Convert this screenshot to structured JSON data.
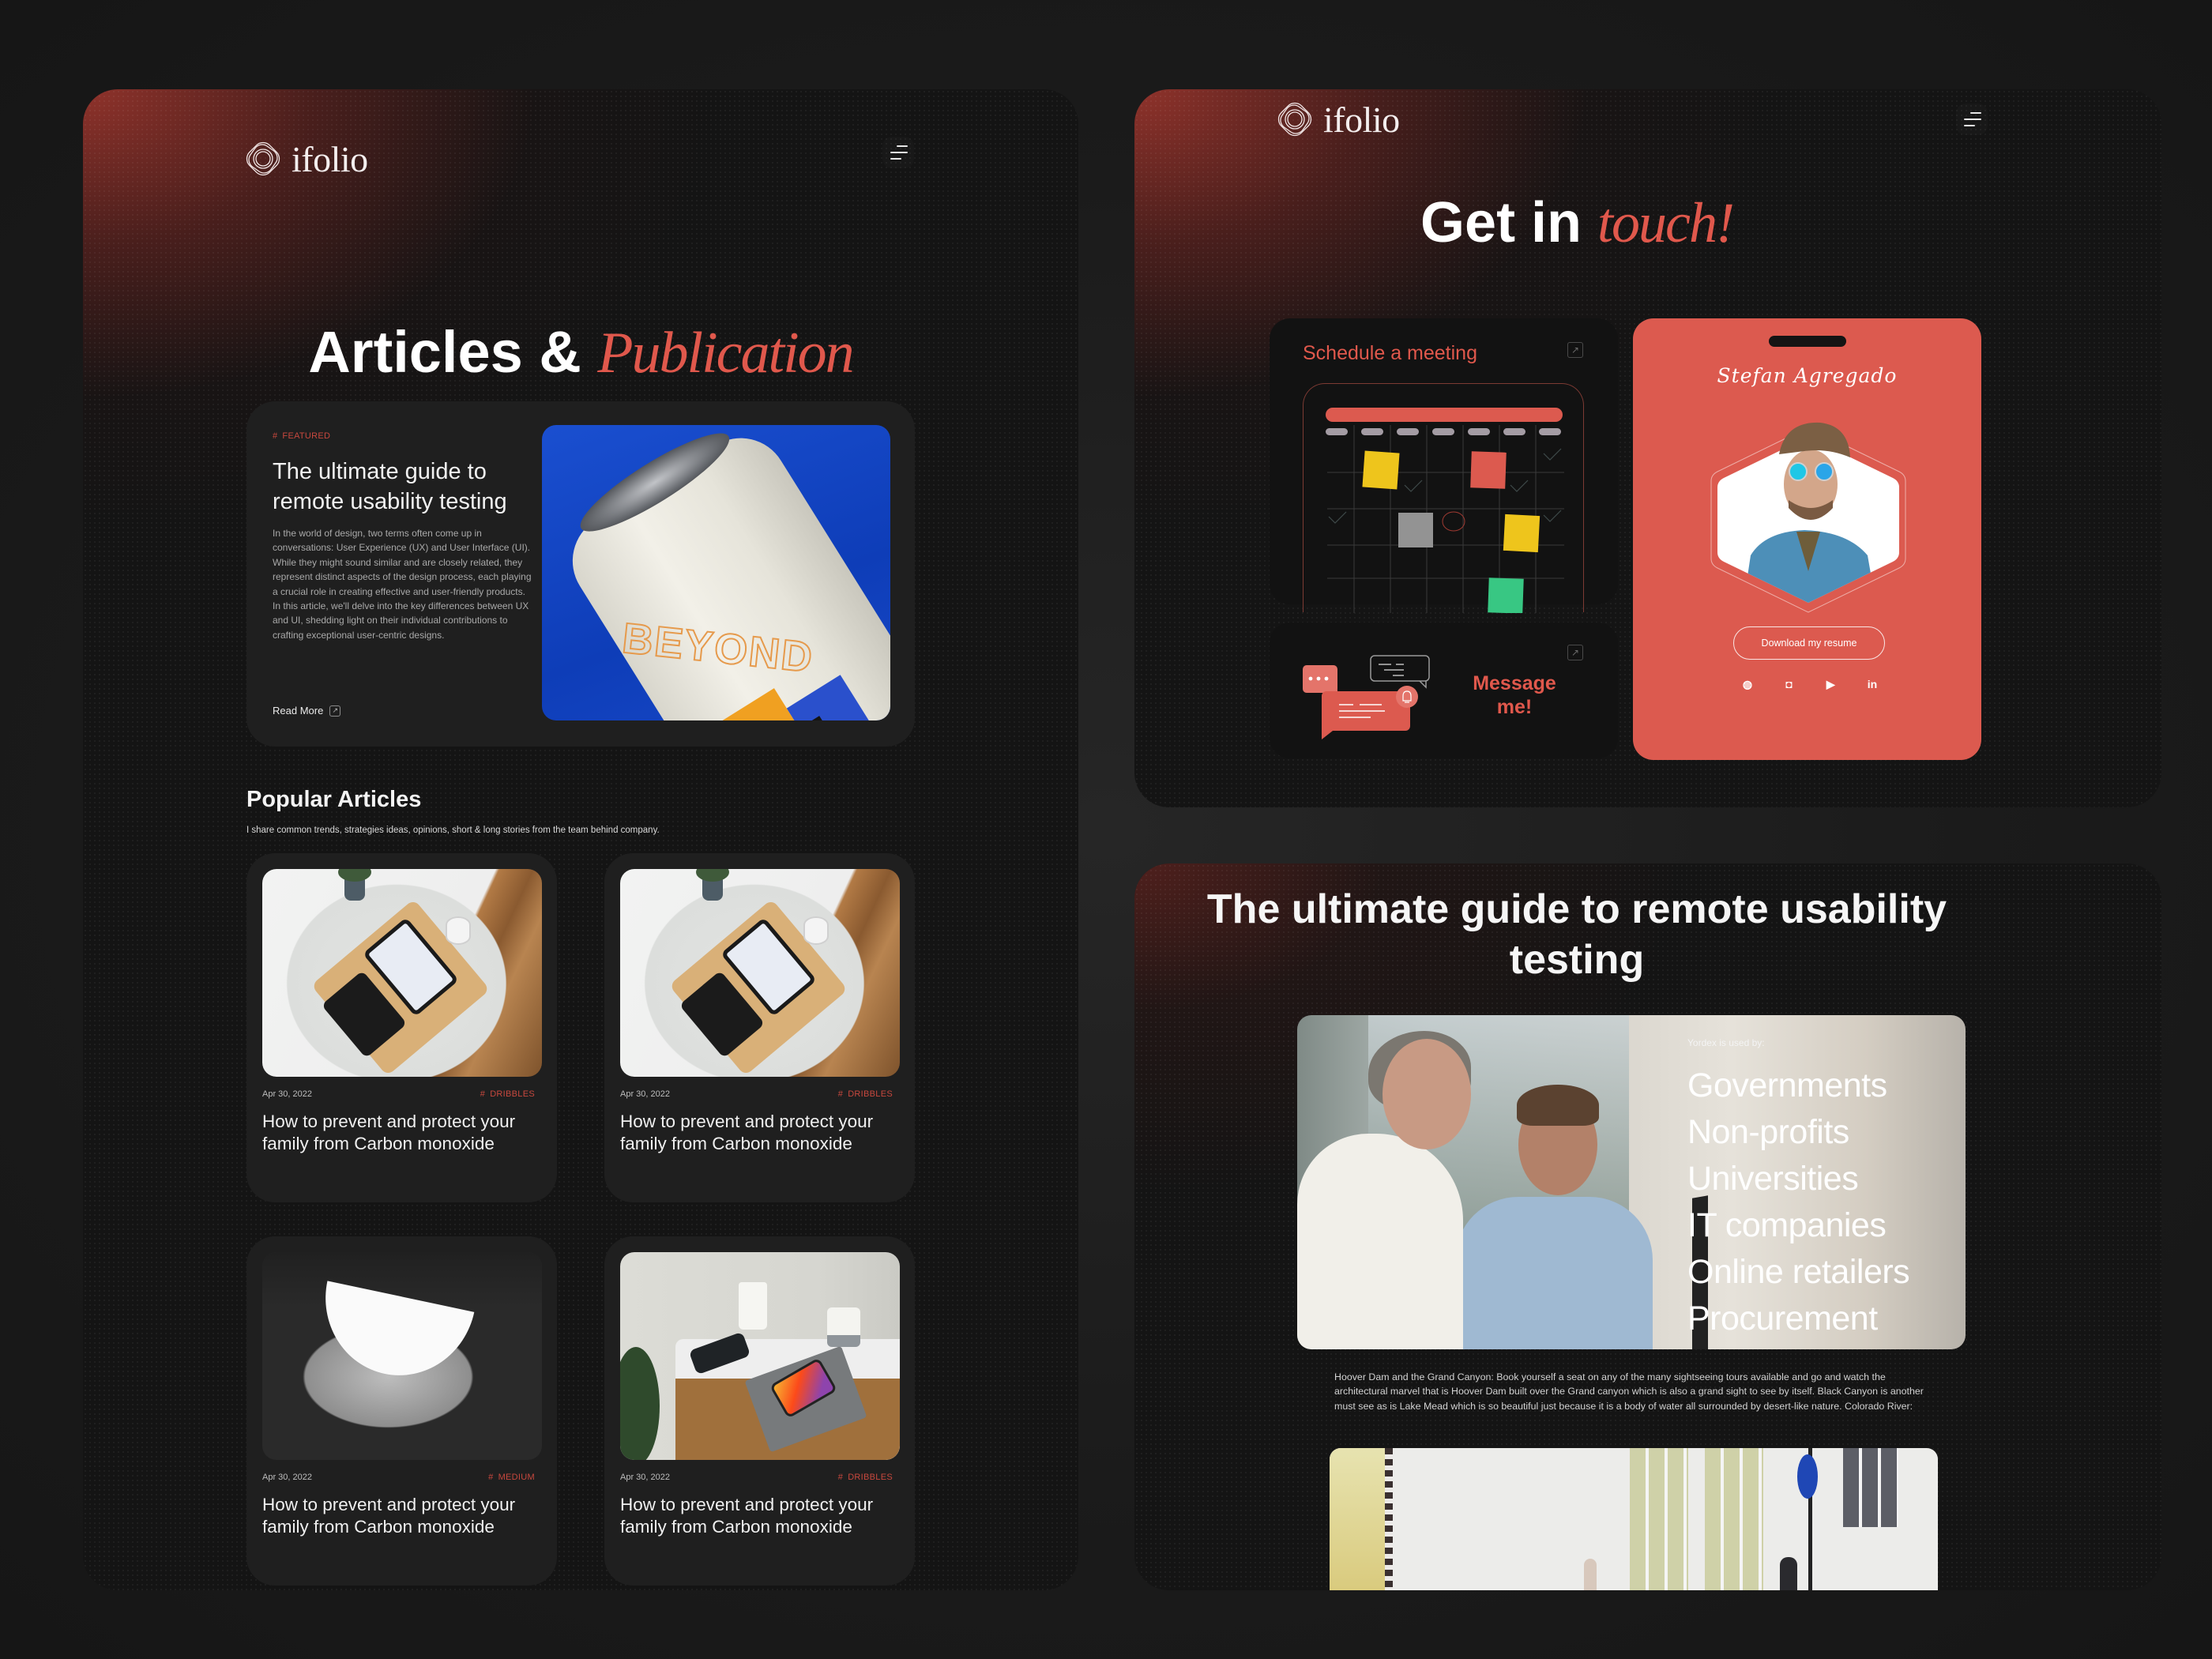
{
  "brand": {
    "name": "ifolio"
  },
  "colors": {
    "accent": "#e0584c",
    "card_red": "#dc5a4f",
    "panel_bg": "#141414",
    "card_bg": "#1f1f1f"
  },
  "articles_page": {
    "menu_icon": "hamburger-menu-icon",
    "title_main": "Articles & ",
    "title_accent": "Publication",
    "featured": {
      "tag": "FEATURED",
      "title": "The ultimate guide to remote usability testing",
      "body": "In the world of design, two terms often come up in conversations: User Experience (UX) and User Interface (UI). While they might sound similar and are closely related, they represent distinct aspects of the design process, each playing a crucial role in creating effective and user-friendly products. In this article, we'll delve into the key differences between UX and UI, shedding light on their individual contributions to crafting exceptional user-centric designs.",
      "read_more": "Read More",
      "image_alt": "Beyond mango drink can on blue background"
    },
    "popular": {
      "title": "Popular Articles",
      "subtitle": "I share common trends, strategies ideas, opinions, short & long stories from the team behind company.",
      "cards": [
        {
          "date": "Apr 30, 2022",
          "tag": "DRIBBLES",
          "title": "How to prevent and protect your family from Carbon monoxide",
          "image": "desk-tray"
        },
        {
          "date": "Apr 30, 2022",
          "tag": "DRIBBLES",
          "title": "How to prevent and protect your family from Carbon monoxide",
          "image": "desk-tray"
        },
        {
          "date": "Apr 30, 2022",
          "tag": "MEDIUM",
          "title": "How to prevent and protect your family from Carbon monoxide",
          "image": "architecture"
        },
        {
          "date": "Apr 30, 2022",
          "tag": "DRIBBLES",
          "title": "How to prevent and protect your family from Carbon monoxide",
          "image": "tech-desk"
        }
      ]
    }
  },
  "contact_page": {
    "menu_icon": "hamburger-menu-icon",
    "title_main": "Get in ",
    "title_accent": "touch!",
    "schedule": {
      "title": "Schedule a meeting",
      "icon": "external-link-icon"
    },
    "message": {
      "label": "Message me!",
      "icon": "external-link-icon"
    },
    "profile": {
      "signature": "Stefan Agregado",
      "resume_button": "Download my resume",
      "socials": [
        {
          "name": "dribbble",
          "glyph": "◍"
        },
        {
          "name": "instagram",
          "glyph": "◘"
        },
        {
          "name": "youtube",
          "glyph": "▶"
        },
        {
          "name": "linkedin",
          "glyph": "in"
        }
      ]
    }
  },
  "blog_post": {
    "title": "The ultimate guide to remote usability testing",
    "used_by_label": "Yordex is used by:",
    "used_by": [
      "Governments",
      "Non-profits",
      "Universities",
      "IT companies",
      "Online retailers",
      "Procurement"
    ],
    "body": "Hoover Dam and the Grand Canyon: Book yourself a seat on any of the many sightseeing tours available and go and watch the architectural marvel that is Hoover Dam built over the Grand canyon which is also a grand sight to see by itself. Black Canyon is another must see as is Lake Mead which is so beautiful just because it is a body of water all surrounded by desert-like nature. Colorado River:"
  }
}
